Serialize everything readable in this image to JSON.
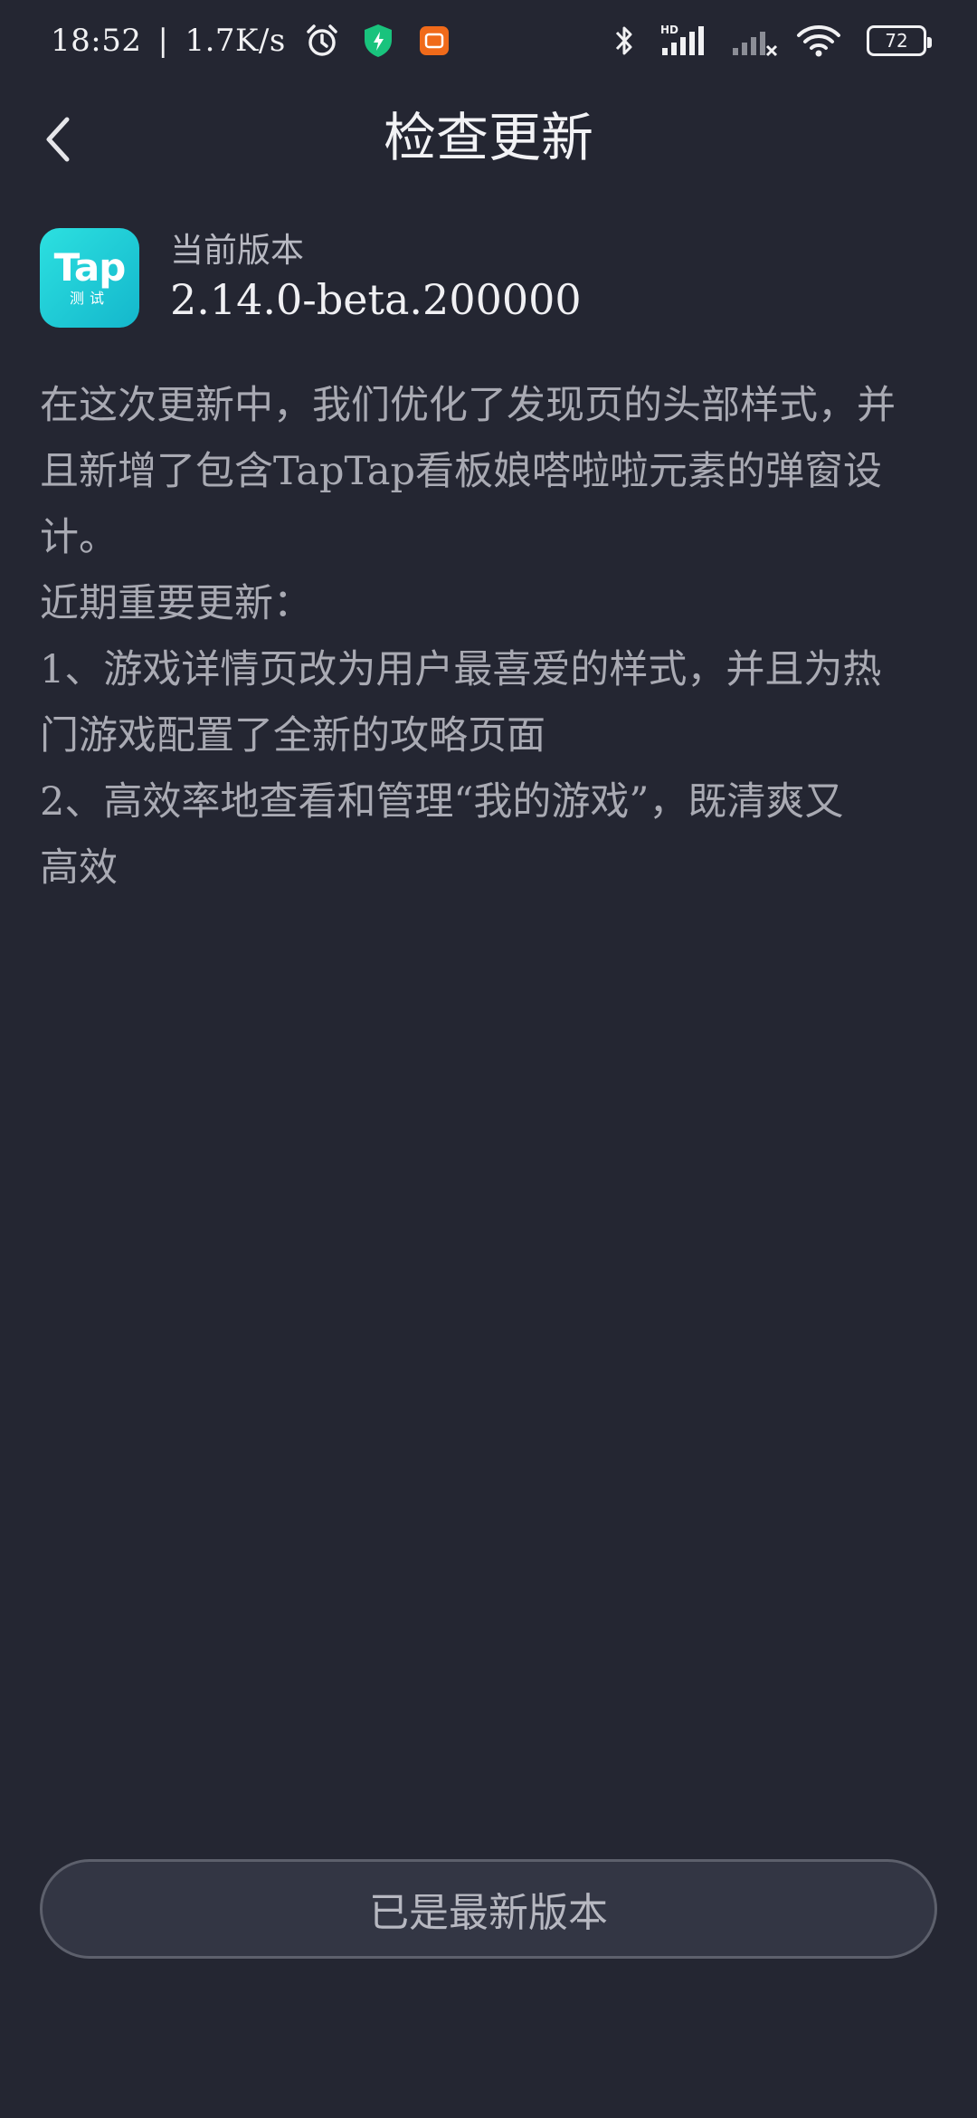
{
  "status_bar": {
    "time": "18:52",
    "separator": "|",
    "net_speed": "1.7K/s",
    "battery": "72",
    "signal_tag": "HD"
  },
  "header": {
    "title": "检查更新"
  },
  "app": {
    "icon_logo": "Tap",
    "icon_sub": "测试",
    "icon_colors": [
      "#2ce0e0",
      "#14b7cc"
    ],
    "version_label": "当前版本",
    "version_value": "2.14.0-beta.200000"
  },
  "notes": {
    "lines": [
      "在这次更新中，我们优化了发现页的头部样式，并",
      "且新增了包含TapTap看板娘嗒啦啦元素的弹窗设",
      "计。",
      "近期重要更新：",
      "1、游戏详情页改为用户最喜爱的样式，并且为热",
      "门游戏配置了全新的攻略页面",
      "2、高效率地查看和管理“我的游戏”，既清爽又",
      "高效"
    ]
  },
  "footer": {
    "button_label": "已是最新版本"
  },
  "colors": {
    "background": "#242632",
    "text_primary": "#f0f0f3",
    "text_secondary": "#a9aab3",
    "shield_green": "#19c37d",
    "app_orange": "#f06a1a"
  }
}
